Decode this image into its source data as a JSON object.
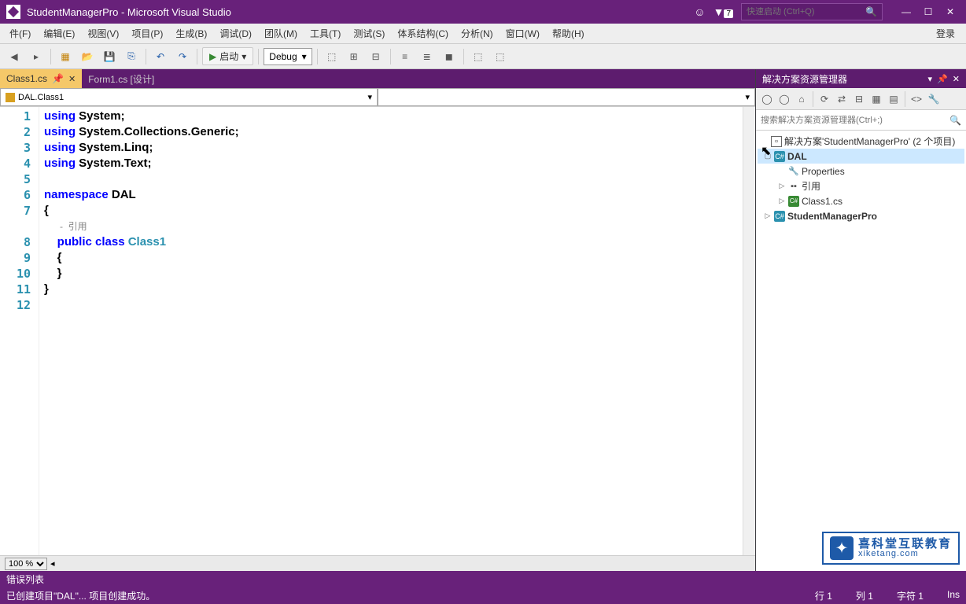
{
  "title": "StudentManagerPro - Microsoft Visual Studio",
  "notification_count": "7",
  "quick_launch_placeholder": "快速启动 (Ctrl+Q)",
  "login_label": "登录",
  "menu": [
    "件(F)",
    "编辑(E)",
    "视图(V)",
    "项目(P)",
    "生成(B)",
    "调试(D)",
    "团队(M)",
    "工具(T)",
    "测试(S)",
    "体系结构(C)",
    "分析(N)",
    "窗口(W)",
    "帮助(H)"
  ],
  "toolbar": {
    "start_label": "启动",
    "config": "Debug"
  },
  "tabs": [
    {
      "label": "Class1.cs",
      "active": true
    },
    {
      "label": "Form1.cs [设计]",
      "active": false
    }
  ],
  "nav_dropdown": "DAL.Class1",
  "code": {
    "line_count": 12,
    "lines": [
      {
        "n": "1",
        "t": [
          [
            "kw",
            "using "
          ],
          [
            "id",
            "System"
          ],
          [
            "p",
            ";"
          ]
        ]
      },
      {
        "n": "2",
        "t": [
          [
            "kw",
            "using "
          ],
          [
            "id",
            "System.Collections.Generic"
          ],
          [
            "p",
            ";"
          ]
        ]
      },
      {
        "n": "3",
        "t": [
          [
            "kw",
            "using "
          ],
          [
            "id",
            "System.Linq"
          ],
          [
            "p",
            ";"
          ]
        ]
      },
      {
        "n": "4",
        "t": [
          [
            "kw",
            "using "
          ],
          [
            "id",
            "System.Text"
          ],
          [
            "p",
            ";"
          ]
        ]
      },
      {
        "n": "5",
        "t": []
      },
      {
        "n": "6",
        "t": [
          [
            "kw",
            "namespace "
          ],
          [
            "id",
            "DAL"
          ]
        ]
      },
      {
        "n": "7",
        "t": [
          [
            "p",
            "{"
          ]
        ]
      },
      {
        "n": "",
        "t": [
          [
            "hint",
            "      -  引用"
          ]
        ]
      },
      {
        "n": "8",
        "t": [
          [
            "id",
            "    "
          ],
          [
            "kw",
            "public class "
          ],
          [
            "type",
            "Class1"
          ]
        ]
      },
      {
        "n": "9",
        "t": [
          [
            "p",
            "    {"
          ]
        ]
      },
      {
        "n": "10",
        "t": [
          [
            "p",
            "    }"
          ]
        ]
      },
      {
        "n": "11",
        "t": [
          [
            "p",
            "}"
          ]
        ]
      },
      {
        "n": "12",
        "t": []
      }
    ]
  },
  "zoom": "100 %",
  "solution": {
    "title": "解决方案资源管理器",
    "search_placeholder": "搜索解决方案资源管理器(Ctrl+;)",
    "root": "解决方案'StudentManagerPro' (2 个项目)",
    "nodes": [
      {
        "name": "DAL",
        "icon": "proj",
        "exp": "▢",
        "depth": 0,
        "bold": true,
        "sel": true
      },
      {
        "name": "Properties",
        "icon": "prop",
        "exp": "",
        "depth": 1
      },
      {
        "name": "引用",
        "icon": "ref",
        "exp": "▷",
        "depth": 1
      },
      {
        "name": "Class1.cs",
        "icon": "cs",
        "exp": "▷",
        "depth": 1
      },
      {
        "name": "StudentManagerPro",
        "icon": "proj",
        "exp": "▷",
        "depth": 0,
        "bold": true
      }
    ]
  },
  "watermark": {
    "cn": "喜科堂互联教育",
    "en": "xiketang.com"
  },
  "error_list": "错误列表",
  "status": {
    "message": "已创建项目\"DAL\"... 项目创建成功。",
    "line_label": "行",
    "line_val": "1",
    "col_label": "列",
    "col_val": "1",
    "char_label": "字符",
    "char_val": "1",
    "ins": "Ins"
  }
}
